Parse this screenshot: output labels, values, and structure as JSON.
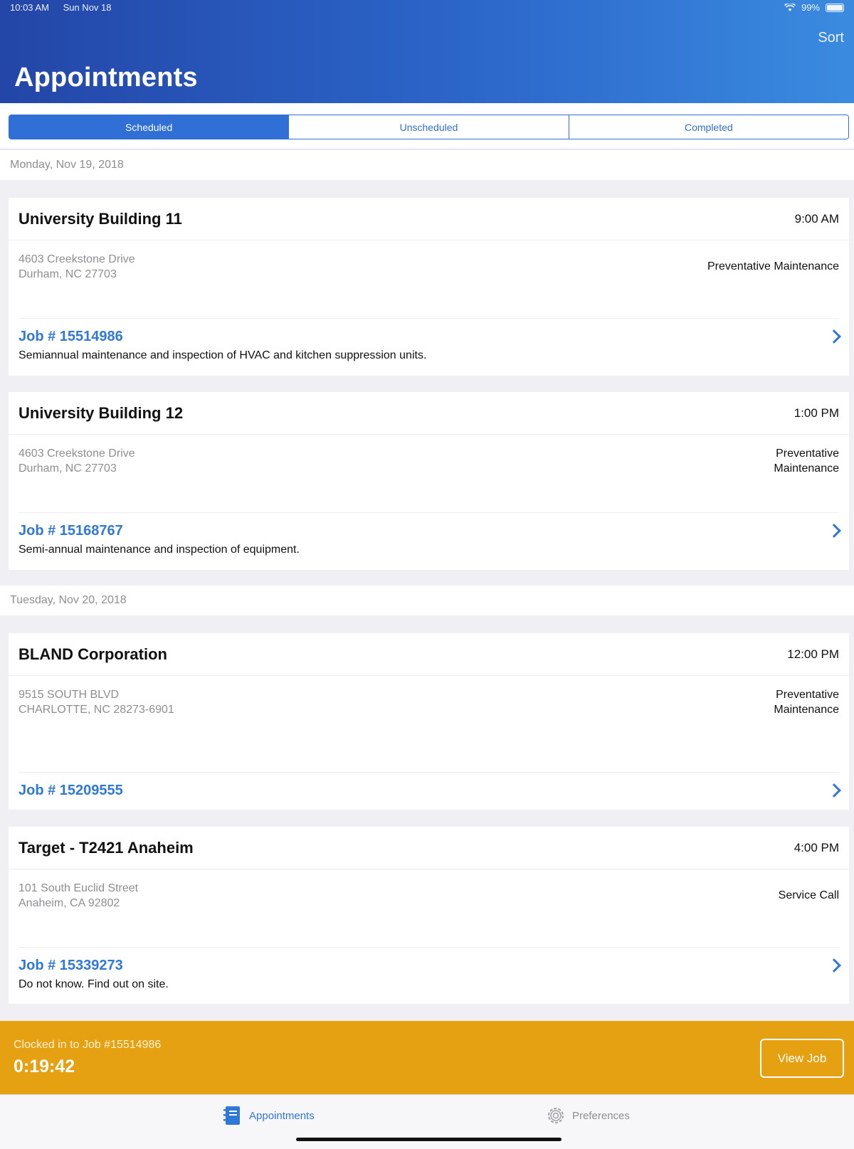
{
  "status_bar": {
    "time": "10:03 AM",
    "date": "Sun Nov 18",
    "battery": "99%"
  },
  "header": {
    "title": "Appointments",
    "sort_label": "Sort"
  },
  "segments": [
    "Scheduled",
    "Unscheduled",
    "Completed"
  ],
  "dates": [
    "Monday, Nov 19, 2018",
    "Tuesday, Nov 20, 2018"
  ],
  "appointments": [
    {
      "name": "University Building 11",
      "time": "9:00 AM",
      "address_line1": "4603 Creekstone Drive",
      "address_line2": "Durham, NC 27703",
      "type_line1": "Preventative Maintenance",
      "type_line2": "",
      "job": "Job # 15514986",
      "description": "Semiannual maintenance and inspection of HVAC and kitchen suppression units."
    },
    {
      "name": "University Building 12",
      "time": "1:00 PM",
      "address_line1": "4603 Creekstone Drive",
      "address_line2": "Durham, NC 27703",
      "type_line1": "Preventative",
      "type_line2": "Maintenance",
      "job": "Job # 15168767",
      "description": "Semi-annual maintenance and inspection of equipment."
    },
    {
      "name": "BLAND Corporation",
      "time": "12:00 PM",
      "address_line1": "9515 SOUTH BLVD",
      "address_line2": "CHARLOTTE, NC 28273-6901",
      "type_line1": "Preventative",
      "type_line2": "Maintenance",
      "job": "Job # 15209555",
      "description": ""
    },
    {
      "name": "Target - T2421 Anaheim",
      "time": "4:00 PM",
      "address_line1": "101 South Euclid Street",
      "address_line2": "Anaheim, CA 92802",
      "type_line1": "Service Call",
      "type_line2": "",
      "job": "Job # 15339273",
      "description": "Do not know.  Find out on site."
    }
  ],
  "clock": {
    "label": "Clocked in to Job #15514986",
    "elapsed": "0:19:42",
    "button": "View Job"
  },
  "tabs": {
    "appointments": "Appointments",
    "preferences": "Preferences"
  },
  "colors": {
    "header_start": "#2346a8",
    "header_end": "#3a8be0",
    "accent": "#2f78d8",
    "clock_bar": "#e6a112"
  },
  "icons": [
    "wifi-icon",
    "battery-icon",
    "chevron-right-icon",
    "notebook-icon",
    "gear-icon"
  ]
}
